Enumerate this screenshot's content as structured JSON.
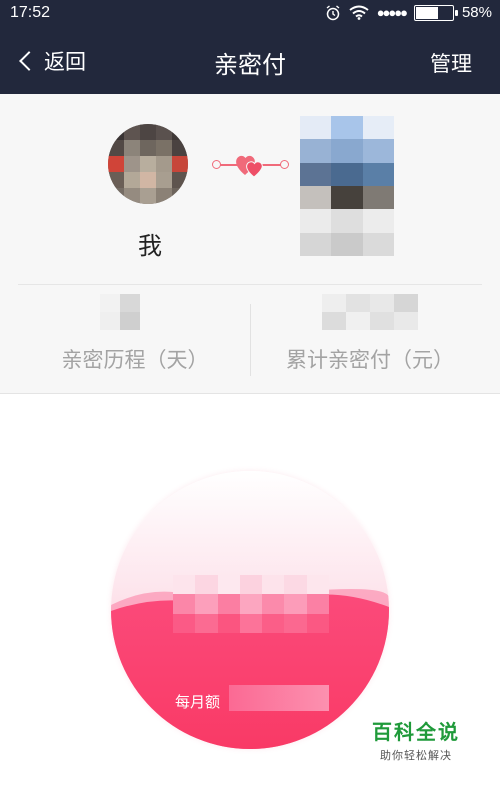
{
  "status_bar": {
    "time": "17:52",
    "signal": "●●●●●",
    "battery_percent": "58%",
    "battery_level": 0.58
  },
  "nav": {
    "back_label": "返回",
    "title": "亲密付",
    "manage_label": "管理"
  },
  "profile": {
    "me_label": "我",
    "stats": [
      {
        "label": "亲密历程（天）"
      },
      {
        "label": "累计亲密付（元）"
      }
    ]
  },
  "limit_circle": {
    "monthly_label": "每月额"
  },
  "watermark": {
    "title": "百科全说",
    "subtitle": "助你轻松解决"
  },
  "colors": {
    "nav_bg": "#22283c",
    "accent_pink": "#f06a7a",
    "wave_pink": "#fb3f72",
    "watermark_green": "#1f9a3a"
  }
}
